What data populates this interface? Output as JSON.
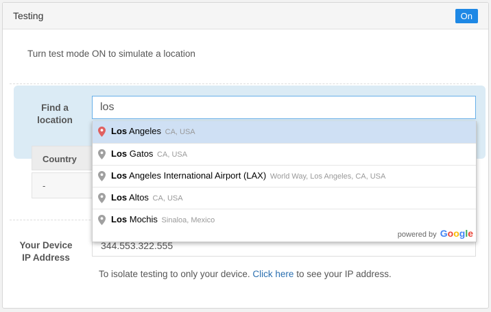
{
  "header": {
    "title": "Testing",
    "toggle_label": "On"
  },
  "intro_text": "Turn test mode ON to simulate a location",
  "find": {
    "label_line1": "Find a",
    "label_line2": "location",
    "input_value": "los"
  },
  "suggestions": [
    {
      "match": "Los",
      "rest": " Angeles",
      "secondary": "CA, USA",
      "selected": true
    },
    {
      "match": "Los",
      "rest": " Gatos",
      "secondary": "CA, USA",
      "selected": false
    },
    {
      "match": "Los",
      "rest": " Angeles International Airport (LAX)",
      "secondary": "World Way, Los Angeles, CA, USA",
      "selected": false
    },
    {
      "match": "Los",
      "rest": " Altos",
      "secondary": "CA, USA",
      "selected": false
    },
    {
      "match": "Los",
      "rest": " Mochis",
      "secondary": "Sinaloa, Mexico",
      "selected": false
    }
  ],
  "powered_by": {
    "text": "powered by",
    "brand": "Google"
  },
  "table": {
    "country_header": "Country",
    "country_value": "-"
  },
  "ip": {
    "label_line1": "Your Device",
    "label_line2": "IP Address",
    "value": "344.553.322.555",
    "help_prefix": "To isolate testing to only your device.",
    "help_link": "Click here",
    "help_suffix": "to see your IP address."
  },
  "colors": {
    "accent": "#1e88e5",
    "selected_pin": "#e06060",
    "pin": "#a0a0a0"
  }
}
